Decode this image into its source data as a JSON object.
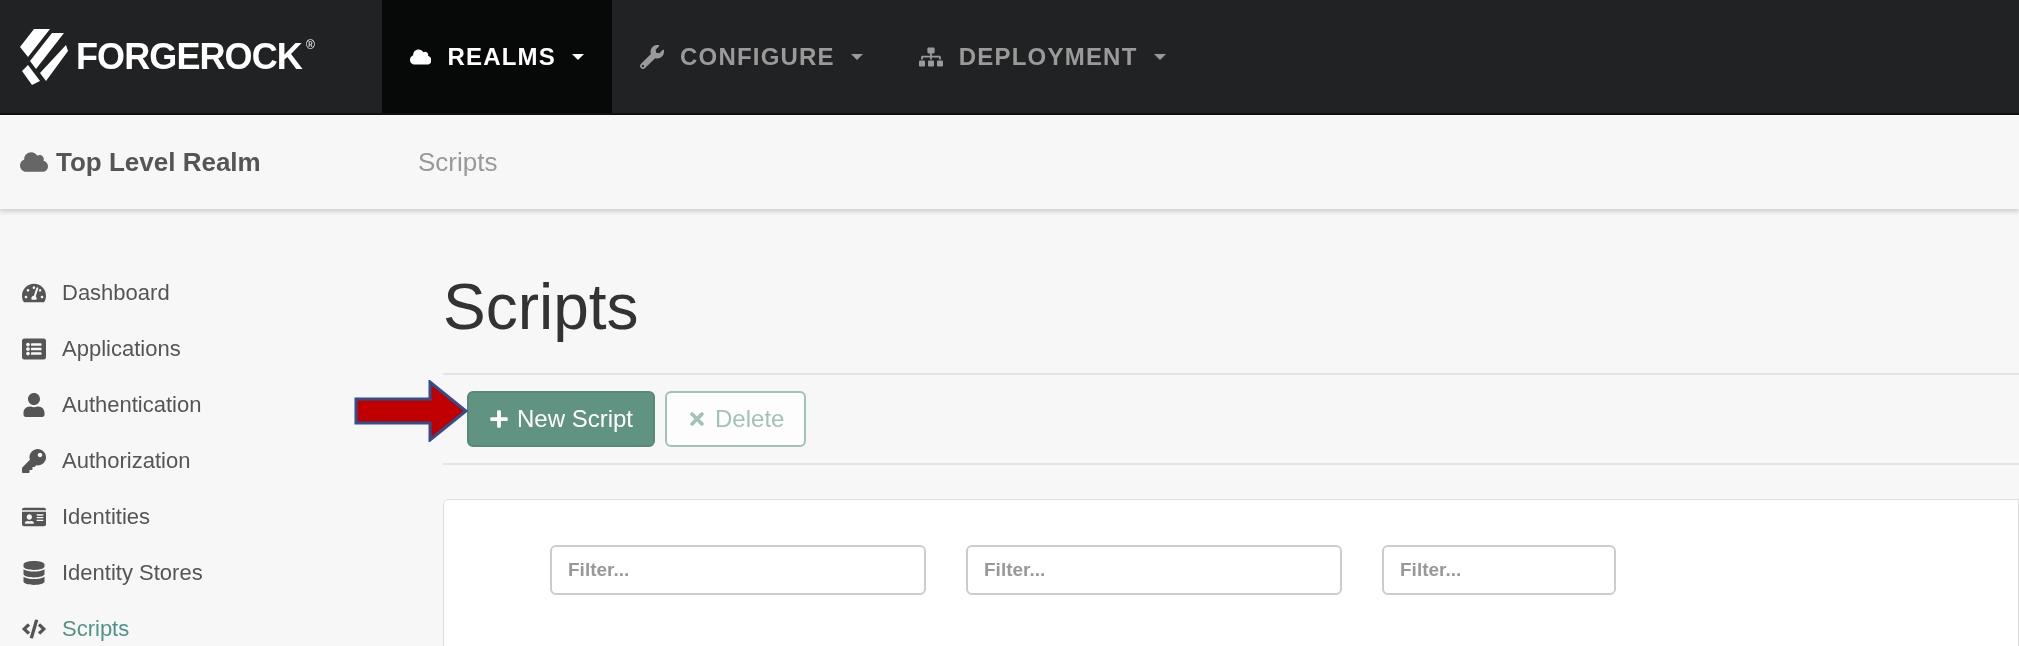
{
  "brand": {
    "name": "FORGEROCK",
    "mark": "®"
  },
  "nav": [
    {
      "label": "REALMS",
      "kind": "cloud",
      "selected": true
    },
    {
      "label": "CONFIGURE",
      "kind": "wrench",
      "selected": false
    },
    {
      "label": "DEPLOYMENT",
      "kind": "sitemap",
      "selected": false
    }
  ],
  "breadcrumb": {
    "realm": "Top Level Realm",
    "page": "Scripts"
  },
  "sidebar": [
    {
      "label": "Dashboard",
      "kind": "gauge",
      "selected": false
    },
    {
      "label": "Applications",
      "kind": "list",
      "selected": false
    },
    {
      "label": "Authentication",
      "kind": "user",
      "selected": false
    },
    {
      "label": "Authorization",
      "kind": "key",
      "selected": false
    },
    {
      "label": "Identities",
      "kind": "idcard",
      "selected": false
    },
    {
      "label": "Identity Stores",
      "kind": "database",
      "selected": false
    },
    {
      "label": "Scripts",
      "kind": "code",
      "selected": true
    }
  ],
  "heading": "Scripts",
  "toolbar": [
    {
      "label": "New Script",
      "kind": "primary",
      "disabled": false
    },
    {
      "label": "Delete",
      "kind": "delete",
      "disabled": true
    }
  ],
  "filters": [
    {
      "placeholder": "Filter..."
    },
    {
      "placeholder": "Filter..."
    },
    {
      "placeholder": "Filter..."
    }
  ]
}
